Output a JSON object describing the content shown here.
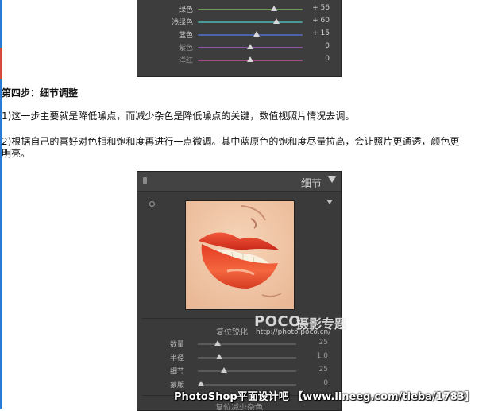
{
  "hsl_panel": {
    "sliders": [
      {
        "label": "绿色",
        "value": "+ 56",
        "position": 0.73,
        "track_color": "#6f9a5a",
        "label_color": "#c9c9c9"
      },
      {
        "label": "浅绿色",
        "value": "+ 60",
        "position": 0.75,
        "track_color": "#4d9a98",
        "label_color": "#c9c9c9"
      },
      {
        "label": "蓝色",
        "value": "+ 15",
        "position": 0.56,
        "track_color": "#5163a8",
        "label_color": "#c9c9c9"
      },
      {
        "label": "紫色",
        "value": "0",
        "position": 0.5,
        "track_color": "#8a58a6",
        "label_color": "#9a9a9a"
      },
      {
        "label": "洋红",
        "value": "0",
        "position": 0.5,
        "track_color": "#a44e86",
        "label_color": "#9a9a9a"
      }
    ]
  },
  "article": {
    "step_title": "第四步：细节调整",
    "para1": "1)这一步主要就是降低噪点，而减少杂色是降低噪点的关键，数值视照片情况去调。",
    "para2": "2)根据自己的喜好对色相和饱和度再进行一点微调。其中蓝原色的饱和度尽量拉高，会让照片更通透，颜色更明亮。"
  },
  "detail_panel": {
    "title": "细节",
    "sharpen_label": "复位锐化",
    "sliders": [
      {
        "label": "数量",
        "value": "25",
        "position": 0.2
      },
      {
        "label": "半径",
        "value": "1.0",
        "position": 0.22
      },
      {
        "label": "细节",
        "value": "25",
        "position": 0.27
      },
      {
        "label": "蒙版",
        "value": "0",
        "position": 0.03
      }
    ],
    "noise_label": "复位减少杂色"
  },
  "watermarks": {
    "logo_latin": "POCO",
    "logo_cn": "摄影专题",
    "url": "http://photo.poco.cn/",
    "bottom": "PhotoShop平面设计吧 【www.lineeg.com/tieba/1783】"
  },
  "colors": {
    "panel_bg": "#3d3d3d",
    "lip": "#e83b22",
    "skin": "#f2c9a8"
  },
  "icons": [
    "panel-grip-icon",
    "collapse-arrow-icon",
    "target-adjust-icon",
    "preview-menu-arrow-icon"
  ]
}
